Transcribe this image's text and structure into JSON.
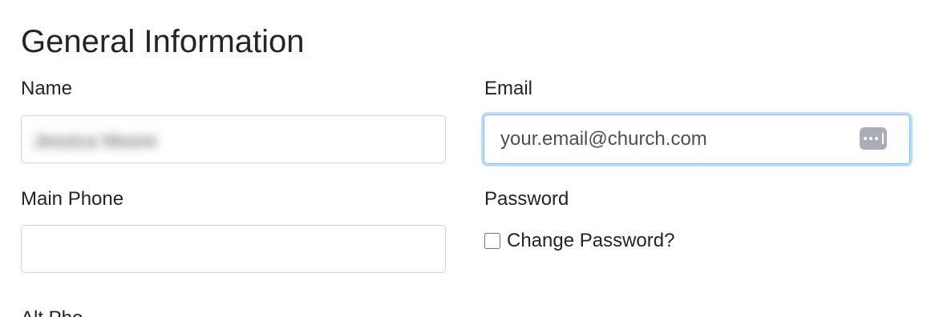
{
  "section": {
    "title": "General Information"
  },
  "fields": {
    "name": {
      "label": "Name",
      "value": "Jessica Moore",
      "placeholder": ""
    },
    "email": {
      "label": "Email",
      "placeholder": "your.email@church.com",
      "value": "",
      "focused": true
    },
    "main_phone": {
      "label": "Main Phone",
      "value": "",
      "placeholder": ""
    },
    "password": {
      "label": "Password",
      "change_checkbox_label": "Change Password?",
      "checked": false
    },
    "alt_phone": {
      "label": "Alt Pho"
    }
  },
  "icons": {
    "password_manager": "password-manager-icon"
  },
  "colors": {
    "focus_border": "#80bdff",
    "input_border": "#ced4da",
    "text": "#212529"
  }
}
